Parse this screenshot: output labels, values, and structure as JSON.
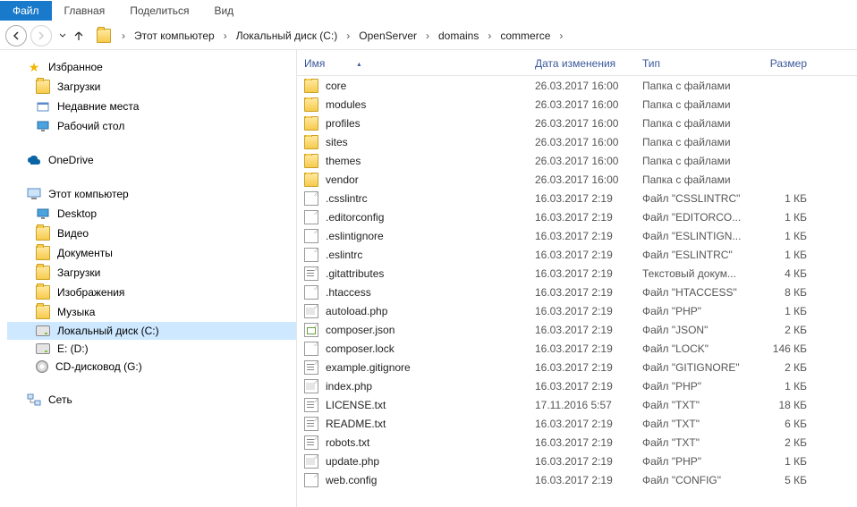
{
  "ribbon": {
    "tabs": [
      {
        "label": "Файл",
        "active": true
      },
      {
        "label": "Главная",
        "active": false
      },
      {
        "label": "Поделиться",
        "active": false
      },
      {
        "label": "Вид",
        "active": false
      }
    ]
  },
  "breadcrumb": [
    {
      "label": "Этот компьютер"
    },
    {
      "label": "Локальный диск (C:)"
    },
    {
      "label": "OpenServer"
    },
    {
      "label": "domains"
    },
    {
      "label": "commerce"
    }
  ],
  "columns": {
    "name": "Имя",
    "date": "Дата изменения",
    "type": "Тип",
    "size": "Размер"
  },
  "sidebar": {
    "favorites": {
      "label": "Избранное",
      "items": [
        {
          "label": "Загрузки",
          "icon": "folder"
        },
        {
          "label": "Недавние места",
          "icon": "recent"
        },
        {
          "label": "Рабочий стол",
          "icon": "desktop"
        }
      ]
    },
    "onedrive": {
      "label": "OneDrive"
    },
    "this_pc": {
      "label": "Этот компьютер",
      "items": [
        {
          "label": "Desktop",
          "icon": "desktop"
        },
        {
          "label": "Видео",
          "icon": "folder"
        },
        {
          "label": "Документы",
          "icon": "folder"
        },
        {
          "label": "Загрузки",
          "icon": "folder"
        },
        {
          "label": "Изображения",
          "icon": "folder"
        },
        {
          "label": "Музыка",
          "icon": "folder"
        },
        {
          "label": "Локальный диск (C:)",
          "icon": "drive",
          "selected": true
        },
        {
          "label": "E: (D:)",
          "icon": "drive"
        },
        {
          "label": "CD-дисковод (G:)",
          "icon": "cd"
        }
      ]
    },
    "network": {
      "label": "Сеть"
    }
  },
  "files": [
    {
      "name": "core",
      "date": "26.03.2017 16:00",
      "type": "Папка с файлами",
      "size": "",
      "icon": "folder"
    },
    {
      "name": "modules",
      "date": "26.03.2017 16:00",
      "type": "Папка с файлами",
      "size": "",
      "icon": "folder"
    },
    {
      "name": "profiles",
      "date": "26.03.2017 16:00",
      "type": "Папка с файлами",
      "size": "",
      "icon": "folder"
    },
    {
      "name": "sites",
      "date": "26.03.2017 16:00",
      "type": "Папка с файлами",
      "size": "",
      "icon": "folder"
    },
    {
      "name": "themes",
      "date": "26.03.2017 16:00",
      "type": "Папка с файлами",
      "size": "",
      "icon": "folder"
    },
    {
      "name": "vendor",
      "date": "26.03.2017 16:00",
      "type": "Папка с файлами",
      "size": "",
      "icon": "folder"
    },
    {
      "name": ".csslintrc",
      "date": "16.03.2017 2:19",
      "type": "Файл \"CSSLINTRC\"",
      "size": "1 КБ",
      "icon": "file"
    },
    {
      "name": ".editorconfig",
      "date": "16.03.2017 2:19",
      "type": "Файл \"EDITORCO...",
      "size": "1 КБ",
      "icon": "file"
    },
    {
      "name": ".eslintignore",
      "date": "16.03.2017 2:19",
      "type": "Файл \"ESLINTIGN...",
      "size": "1 КБ",
      "icon": "file"
    },
    {
      "name": ".eslintrc",
      "date": "16.03.2017 2:19",
      "type": "Файл \"ESLINTRC\"",
      "size": "1 КБ",
      "icon": "file"
    },
    {
      "name": ".gitattributes",
      "date": "16.03.2017 2:19",
      "type": "Текстовый докум...",
      "size": "4 КБ",
      "icon": "txt"
    },
    {
      "name": ".htaccess",
      "date": "16.03.2017 2:19",
      "type": "Файл \"HTACCESS\"",
      "size": "8 КБ",
      "icon": "file"
    },
    {
      "name": "autoload.php",
      "date": "16.03.2017 2:19",
      "type": "Файл \"PHP\"",
      "size": "1 КБ",
      "icon": "php"
    },
    {
      "name": "composer.json",
      "date": "16.03.2017 2:19",
      "type": "Файл \"JSON\"",
      "size": "2 КБ",
      "icon": "json"
    },
    {
      "name": "composer.lock",
      "date": "16.03.2017 2:19",
      "type": "Файл \"LOCK\"",
      "size": "146 КБ",
      "icon": "file"
    },
    {
      "name": "example.gitignore",
      "date": "16.03.2017 2:19",
      "type": "Файл \"GITIGNORE\"",
      "size": "2 КБ",
      "icon": "txt"
    },
    {
      "name": "index.php",
      "date": "16.03.2017 2:19",
      "type": "Файл \"PHP\"",
      "size": "1 КБ",
      "icon": "php"
    },
    {
      "name": "LICENSE.txt",
      "date": "17.11.2016 5:57",
      "type": "Файл \"TXT\"",
      "size": "18 КБ",
      "icon": "txt"
    },
    {
      "name": "README.txt",
      "date": "16.03.2017 2:19",
      "type": "Файл \"TXT\"",
      "size": "6 КБ",
      "icon": "txt"
    },
    {
      "name": "robots.txt",
      "date": "16.03.2017 2:19",
      "type": "Файл \"TXT\"",
      "size": "2 КБ",
      "icon": "txt"
    },
    {
      "name": "update.php",
      "date": "16.03.2017 2:19",
      "type": "Файл \"PHP\"",
      "size": "1 КБ",
      "icon": "php"
    },
    {
      "name": "web.config",
      "date": "16.03.2017 2:19",
      "type": "Файл \"CONFIG\"",
      "size": "5 КБ",
      "icon": "file"
    }
  ]
}
